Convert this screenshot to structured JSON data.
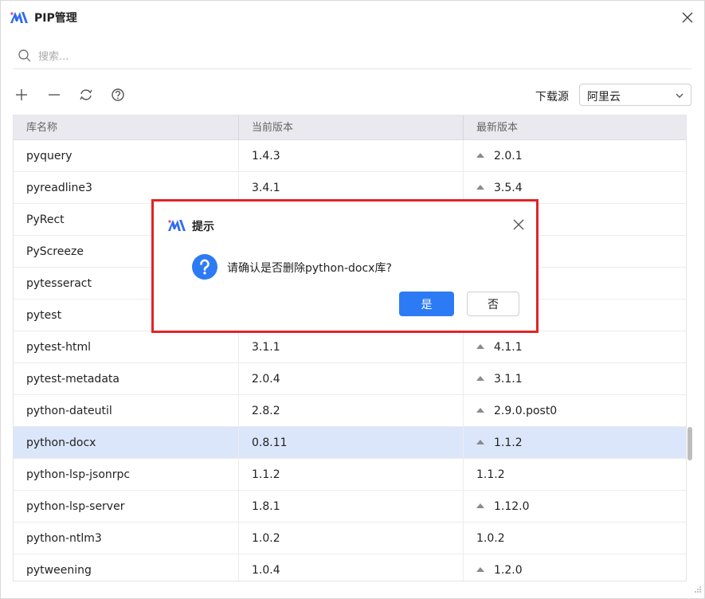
{
  "window": {
    "title": "PIP管理"
  },
  "search": {
    "placeholder": "搜索..."
  },
  "toolbar": {
    "icons": [
      "plus-icon",
      "minus-icon",
      "refresh-icon",
      "help-icon"
    ],
    "source_label": "下载源",
    "source_value": "阿里云"
  },
  "table": {
    "headers": [
      "库名称",
      "当前版本",
      "最新版本"
    ],
    "rows": [
      {
        "name": "pyquery",
        "current": "1.4.3",
        "latest": "2.0.1",
        "upgradable": true
      },
      {
        "name": "pyreadline3",
        "current": "3.4.1",
        "latest": "3.5.4",
        "upgradable": true
      },
      {
        "name": "PyRect",
        "current": "",
        "latest": "",
        "upgradable": false
      },
      {
        "name": "PyScreeze",
        "current": "",
        "latest": "",
        "upgradable": false
      },
      {
        "name": "pytesseract",
        "current": "",
        "latest": "",
        "upgradable": false
      },
      {
        "name": "pytest",
        "current": "",
        "latest": "",
        "upgradable": false
      },
      {
        "name": "pytest-html",
        "current": "3.1.1",
        "latest": "4.1.1",
        "upgradable": true
      },
      {
        "name": "pytest-metadata",
        "current": "2.0.4",
        "latest": "3.1.1",
        "upgradable": true
      },
      {
        "name": "python-dateutil",
        "current": "2.8.2",
        "latest": "2.9.0.post0",
        "upgradable": true
      },
      {
        "name": "python-docx",
        "current": "0.8.11",
        "latest": "1.1.2",
        "upgradable": true,
        "selected": true
      },
      {
        "name": "python-lsp-jsonrpc",
        "current": "1.1.2",
        "latest": "1.1.2",
        "upgradable": false
      },
      {
        "name": "python-lsp-server",
        "current": "1.8.1",
        "latest": "1.12.0",
        "upgradable": true
      },
      {
        "name": "python-ntlm3",
        "current": "1.0.2",
        "latest": "1.0.2",
        "upgradable": false
      },
      {
        "name": "pytweening",
        "current": "1.0.4",
        "latest": "1.2.0",
        "upgradable": true
      }
    ]
  },
  "dialog": {
    "title": "提示",
    "message": "请确认是否删除python-docx库?",
    "yes_label": "是",
    "no_label": "否"
  },
  "colors": {
    "accent": "#2c7bf4",
    "selected_row": "#dbe6fb",
    "highlight_border": "#e12428"
  }
}
